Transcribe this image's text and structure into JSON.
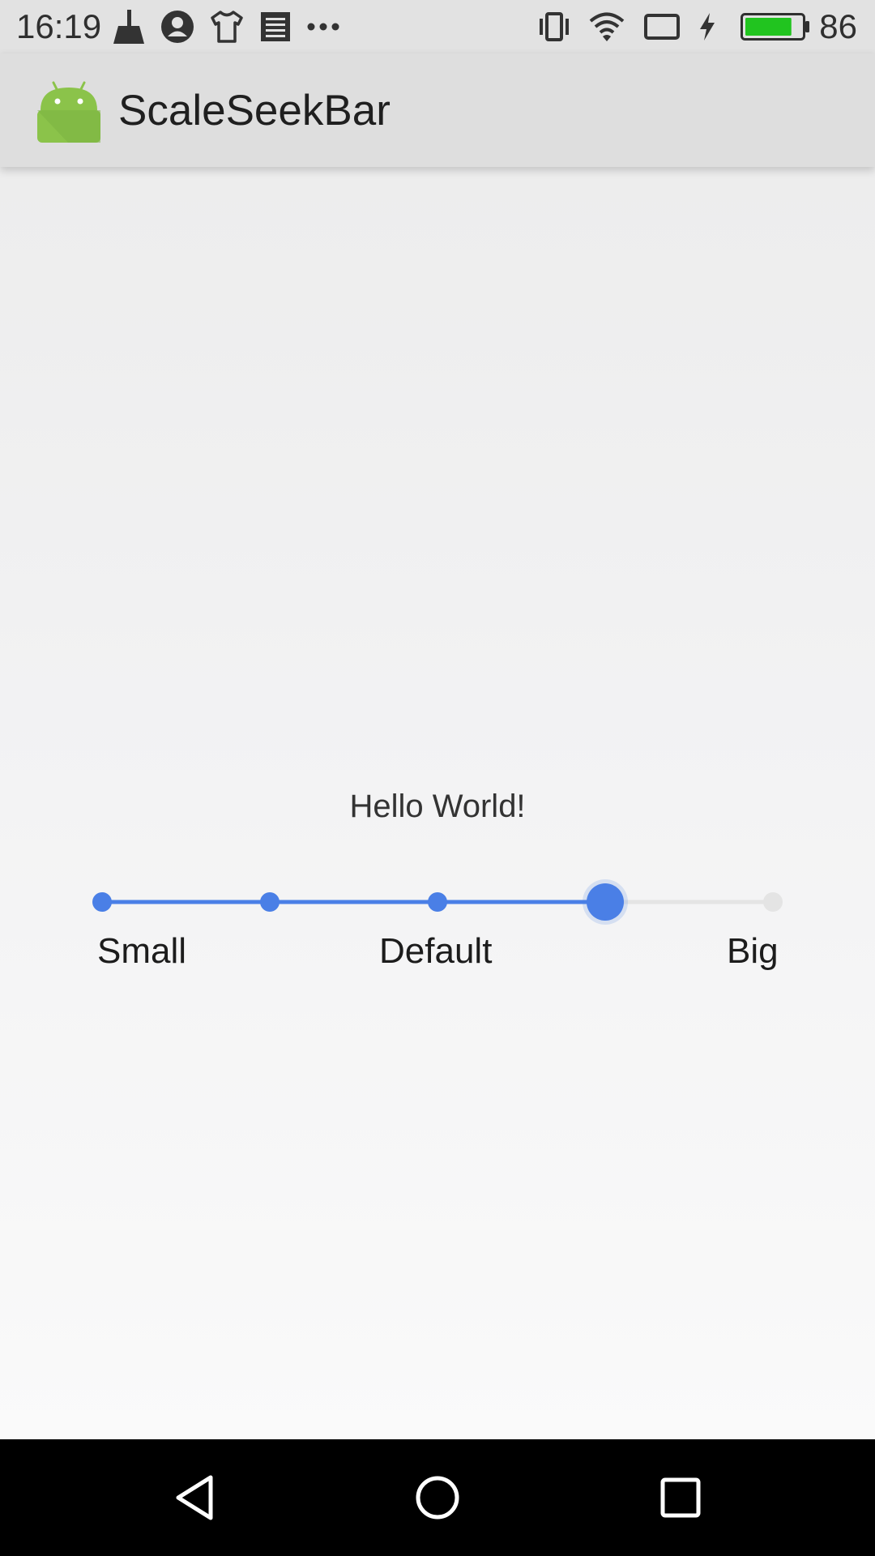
{
  "status_bar": {
    "time": "16:19",
    "left_icons": [
      "broom-icon",
      "account-circle-icon",
      "tshirt-icon",
      "news-icon",
      "more-dots-icon"
    ],
    "right_icons": [
      "vibrate-icon",
      "wifi-icon",
      "cast-icon",
      "charging-bolt-icon",
      "battery-icon"
    ],
    "battery_level": "86",
    "battery_fill_fraction": 0.86,
    "battery_color": "#21c41f"
  },
  "app_bar": {
    "title": "ScaleSeekBar",
    "icon": "android-robot-icon",
    "icon_color": "#8bc34a"
  },
  "main": {
    "text": "Hello World!"
  },
  "seekbar": {
    "ticks": 5,
    "selected_index": 3,
    "active_color": "#4a7fe6",
    "inactive_color": "#e4e4e4",
    "labels": {
      "small": "Small",
      "default": "Default",
      "big": "Big"
    }
  },
  "nav_bar": {
    "buttons": [
      "back-triangle-icon",
      "home-circle-icon",
      "recents-square-icon"
    ]
  }
}
